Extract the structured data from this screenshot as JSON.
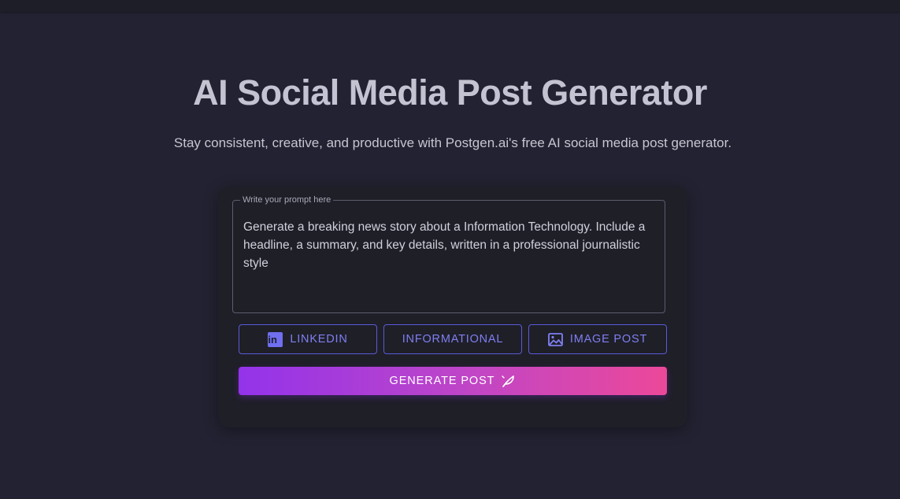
{
  "hero": {
    "title": "AI Social Media Post Generator",
    "subtitle": "Stay consistent, creative, and productive with Postgen.ai's free AI social media post generator."
  },
  "prompt": {
    "legend": "Write your prompt here",
    "value": "Generate a breaking news story about a Information Technology. Include a headline, a summary, and key details, written in a professional journalistic style"
  },
  "options": {
    "platform": {
      "label": "LINKEDIN",
      "icon": "linkedin-icon",
      "icon_text": "in"
    },
    "tone": {
      "label": "INFORMATIONAL"
    },
    "format": {
      "label": "IMAGE POST",
      "icon": "image-icon"
    }
  },
  "generate": {
    "label": "GENERATE POST",
    "icon": "quill-icon"
  },
  "colors": {
    "background": "#222232",
    "card": "#1f1f28",
    "accent": "#7f7ff2",
    "gradient_start": "#9333ea",
    "gradient_end": "#ec4899"
  }
}
